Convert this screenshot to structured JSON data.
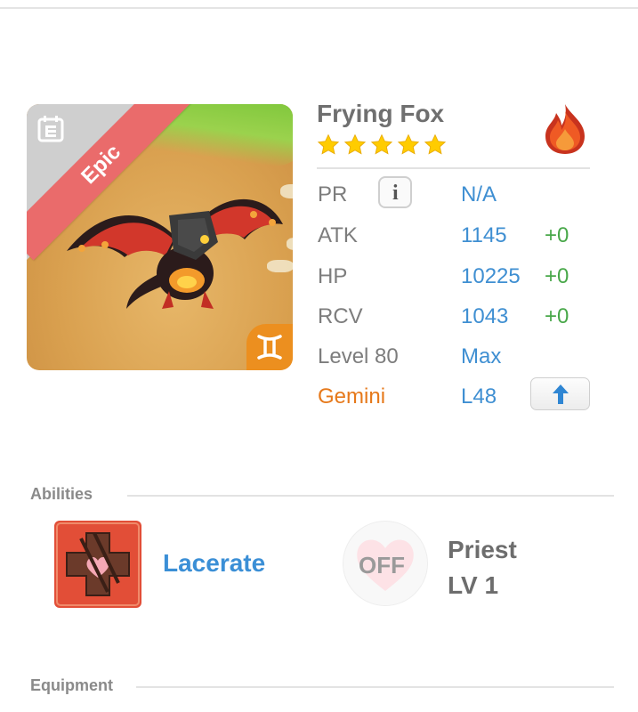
{
  "creature": {
    "name": "Frying Fox",
    "rarity": "Epic",
    "stars": 5,
    "element": "fire-icon",
    "sign_icon": "gemini-icon"
  },
  "stats": {
    "pr": {
      "label": "PR",
      "value": "N/A"
    },
    "atk": {
      "label": "ATK",
      "value": "1145",
      "bonus": "+0"
    },
    "hp": {
      "label": "HP",
      "value": "10225",
      "bonus": "+0"
    },
    "rcv": {
      "label": "RCV",
      "value": "1043",
      "bonus": "+0"
    },
    "level": {
      "label": "Level 80",
      "value": "Max"
    },
    "sign": {
      "label": "Gemini",
      "value": "L48"
    }
  },
  "abilities": {
    "title": "Abilities",
    "skill_name": "Lacerate",
    "toggle_label": "OFF",
    "class_name": "Priest",
    "class_level": "LV 1"
  },
  "equipment": {
    "title": "Equipment"
  },
  "colors": {
    "value_blue": "#3f8fd2",
    "bonus_green": "#49a84a",
    "sign_orange": "#e6791b",
    "epic_ribbon": "#ea6b6b"
  }
}
